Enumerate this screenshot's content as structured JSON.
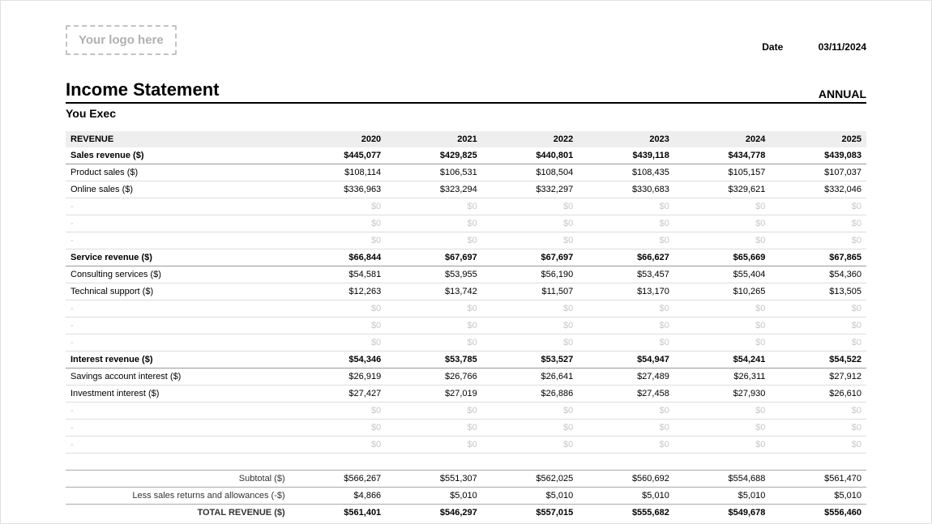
{
  "header": {
    "logo_placeholder": "Your logo here",
    "date_label": "Date",
    "date_value": "03/11/2024",
    "title": "Income Statement",
    "period": "ANNUAL",
    "company": "You Exec"
  },
  "table": {
    "section_label": "REVENUE",
    "years": [
      "2020",
      "2021",
      "2022",
      "2023",
      "2024",
      "2025"
    ],
    "groups": [
      {
        "header": {
          "label": "Sales revenue ($)",
          "values": [
            "$445,077",
            "$429,825",
            "$440,801",
            "$439,118",
            "$434,778",
            "$439,083"
          ]
        },
        "rows": [
          {
            "label": "Product sales ($)",
            "values": [
              "$108,114",
              "$106,531",
              "$108,504",
              "$108,435",
              "$105,157",
              "$107,037"
            ],
            "zero": false
          },
          {
            "label": "Online sales ($)",
            "values": [
              "$336,963",
              "$323,294",
              "$332,297",
              "$330,683",
              "$329,621",
              "$332,046"
            ],
            "zero": false
          },
          {
            "label": "-",
            "values": [
              "$0",
              "$0",
              "$0",
              "$0",
              "$0",
              "$0"
            ],
            "zero": true
          },
          {
            "label": "-",
            "values": [
              "$0",
              "$0",
              "$0",
              "$0",
              "$0",
              "$0"
            ],
            "zero": true
          },
          {
            "label": "-",
            "values": [
              "$0",
              "$0",
              "$0",
              "$0",
              "$0",
              "$0"
            ],
            "zero": true
          }
        ]
      },
      {
        "header": {
          "label": "Service revenue ($)",
          "values": [
            "$66,844",
            "$67,697",
            "$67,697",
            "$66,627",
            "$65,669",
            "$67,865"
          ]
        },
        "rows": [
          {
            "label": "Consulting services ($)",
            "values": [
              "$54,581",
              "$53,955",
              "$56,190",
              "$53,457",
              "$55,404",
              "$54,360"
            ],
            "zero": false
          },
          {
            "label": "Technical support ($)",
            "values": [
              "$12,263",
              "$13,742",
              "$11,507",
              "$13,170",
              "$10,265",
              "$13,505"
            ],
            "zero": false
          },
          {
            "label": "-",
            "values": [
              "$0",
              "$0",
              "$0",
              "$0",
              "$0",
              "$0"
            ],
            "zero": true
          },
          {
            "label": "-",
            "values": [
              "$0",
              "$0",
              "$0",
              "$0",
              "$0",
              "$0"
            ],
            "zero": true
          },
          {
            "label": "-",
            "values": [
              "$0",
              "$0",
              "$0",
              "$0",
              "$0",
              "$0"
            ],
            "zero": true
          }
        ]
      },
      {
        "header": {
          "label": "Interest revenue ($)",
          "values": [
            "$54,346",
            "$53,785",
            "$53,527",
            "$54,947",
            "$54,241",
            "$54,522"
          ]
        },
        "rows": [
          {
            "label": "Savings account interest ($)",
            "values": [
              "$26,919",
              "$26,766",
              "$26,641",
              "$27,489",
              "$26,311",
              "$27,912"
            ],
            "zero": false
          },
          {
            "label": "Investment interest ($)",
            "values": [
              "$27,427",
              "$27,019",
              "$26,886",
              "$27,458",
              "$27,930",
              "$26,610"
            ],
            "zero": false
          },
          {
            "label": "-",
            "values": [
              "$0",
              "$0",
              "$0",
              "$0",
              "$0",
              "$0"
            ],
            "zero": true
          },
          {
            "label": "-",
            "values": [
              "$0",
              "$0",
              "$0",
              "$0",
              "$0",
              "$0"
            ],
            "zero": true
          },
          {
            "label": "-",
            "values": [
              "$0",
              "$0",
              "$0",
              "$0",
              "$0",
              "$0"
            ],
            "zero": true
          }
        ]
      }
    ],
    "subtotal": {
      "label": "Subtotal ($)",
      "values": [
        "$566,267",
        "$551,307",
        "$562,025",
        "$560,692",
        "$554,688",
        "$561,470"
      ]
    },
    "allowances": {
      "label": "Less sales returns and allowances (-$)",
      "values": [
        "$4,866",
        "$5,010",
        "$5,010",
        "$5,010",
        "$5,010",
        "$5,010"
      ]
    },
    "total": {
      "label": "TOTAL REVENUE ($)",
      "values": [
        "$561,401",
        "$546,297",
        "$557,015",
        "$555,682",
        "$549,678",
        "$556,460"
      ]
    }
  }
}
